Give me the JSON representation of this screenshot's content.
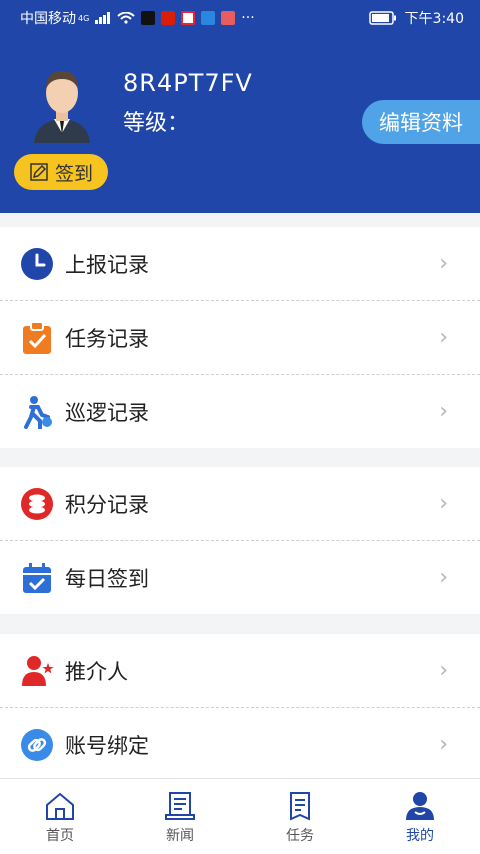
{
  "status_bar": {
    "carrier": "中国移动",
    "network": "4G",
    "time": "下午3:40",
    "more": "···"
  },
  "profile": {
    "user_id": "8R4PT7FV",
    "level_label": "等级：",
    "edit_label": "编辑资料",
    "checkin_label": "签到"
  },
  "menu_groups": [
    {
      "items": [
        {
          "label": "上报记录",
          "icon": "clock-icon"
        },
        {
          "label": "任务记录",
          "icon": "clipboard-check-icon"
        },
        {
          "label": "巡逻记录",
          "icon": "walking-person-icon"
        }
      ]
    },
    {
      "items": [
        {
          "label": "积分记录",
          "icon": "coins-icon"
        },
        {
          "label": "每日签到",
          "icon": "calendar-check-icon"
        }
      ]
    },
    {
      "items": [
        {
          "label": "推介人",
          "icon": "person-star-icon"
        },
        {
          "label": "账号绑定",
          "icon": "link-icon"
        }
      ]
    }
  ],
  "tabbar": {
    "tabs": [
      {
        "label": "首页",
        "icon": "home-icon"
      },
      {
        "label": "新闻",
        "icon": "news-icon"
      },
      {
        "label": "任务",
        "icon": "task-icon"
      },
      {
        "label": "我的",
        "icon": "profile-icon"
      }
    ],
    "active": "我的"
  },
  "colors": {
    "header_bg": "#1f46a8",
    "edit_button": "#4fa3e6",
    "checkin_button": "#f7c41f",
    "active_tab": "#1f46a8"
  }
}
